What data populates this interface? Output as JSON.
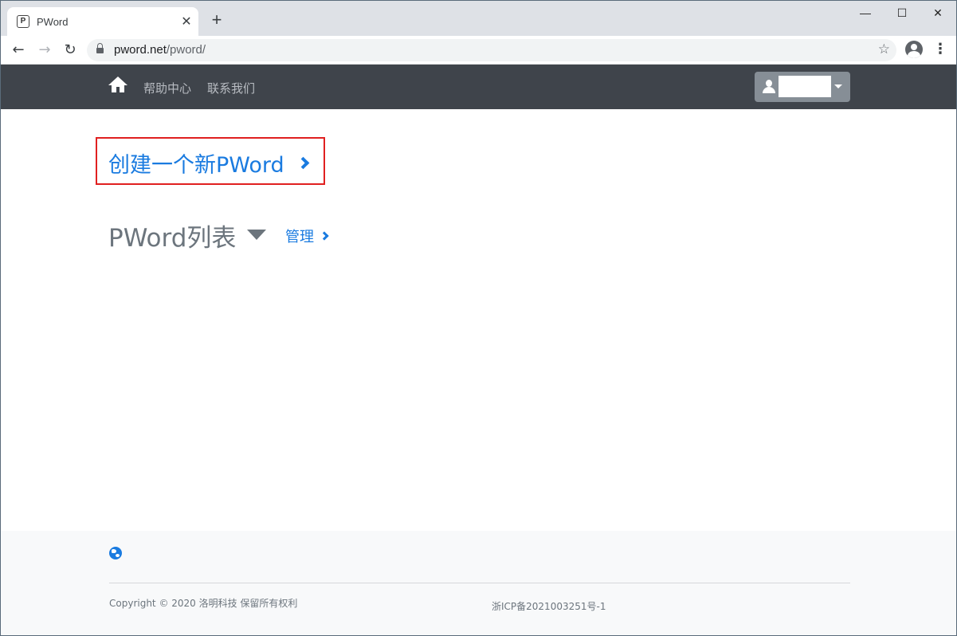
{
  "browser": {
    "tab_title": "PWord",
    "favicon_glyph": "P",
    "tab_close_glyph": "✕",
    "new_tab_glyph": "+",
    "url_host": "pword.net",
    "url_path": "/pword/",
    "window_controls": {
      "minimize": "—",
      "maximize": "☐",
      "close": "✕"
    },
    "icons": {
      "back": "arrow-left-icon",
      "forward": "arrow-right-icon",
      "reload": "reload-icon",
      "lock": "lock-icon",
      "star": "star-icon",
      "profile": "profile-icon",
      "menu": "kebab-menu-icon"
    }
  },
  "navbar": {
    "home_icon": "home-icon",
    "links": [
      "帮助中心",
      "联系我们"
    ],
    "user_icon": "user-icon",
    "background_color": "#3f444b"
  },
  "main": {
    "create_link": "创建一个新PWord",
    "list_heading": "PWord列表",
    "manage_link": "管理",
    "accent_color": "#1a7be0",
    "highlight_color": "#e02020"
  },
  "footer": {
    "globe_icon": "globe-icon",
    "copyright": "Copyright © 2020 洛明科技 保留所有权利",
    "icp": "浙ICP备2021003251号-1"
  }
}
